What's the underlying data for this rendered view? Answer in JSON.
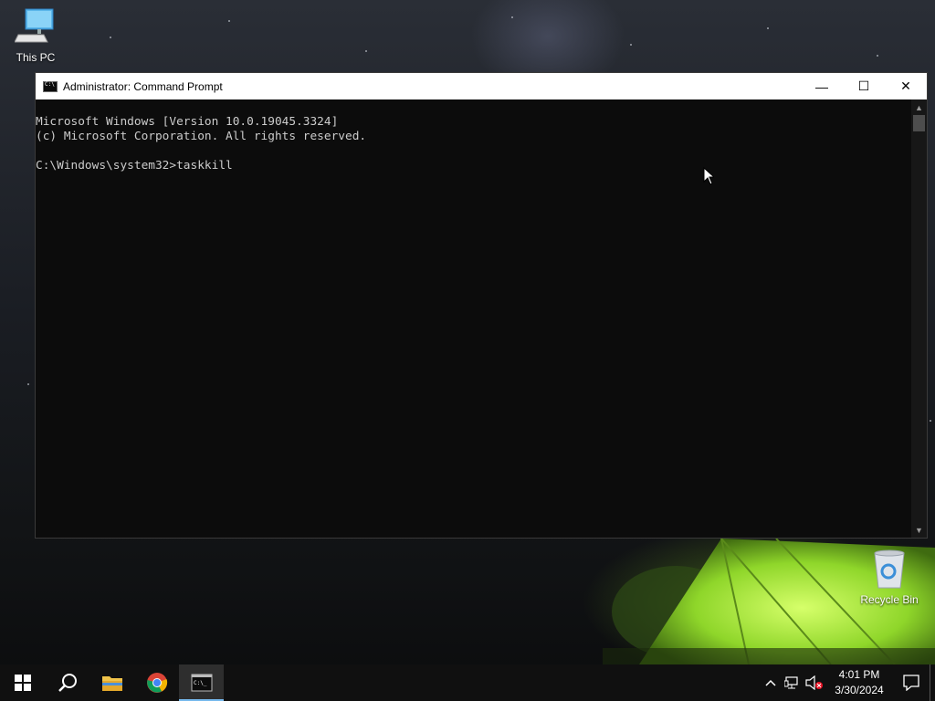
{
  "desktop": {
    "icons": [
      {
        "label": "This PC"
      },
      {
        "label": "Recycle Bin"
      }
    ]
  },
  "window": {
    "title": "Administrator: Command Prompt",
    "controls": {
      "minimize": "—",
      "maximize": "☐",
      "close": "✕"
    },
    "console_lines": [
      "Microsoft Windows [Version 10.0.19045.3324]",
      "(c) Microsoft Corporation. All rights reserved.",
      "",
      "C:\\Windows\\system32>taskkill"
    ]
  },
  "taskbar": {
    "pinned": [
      {
        "name": "start-button",
        "icon": "windows-logo"
      },
      {
        "name": "search-button",
        "icon": "search-icon"
      },
      {
        "name": "file-explorer-button",
        "icon": "folder-icon"
      },
      {
        "name": "chrome-button",
        "icon": "chrome-icon"
      },
      {
        "name": "command-prompt-button",
        "icon": "cmd-icon",
        "active": true
      }
    ],
    "clock": {
      "time": "4:01 PM",
      "date": "3/30/2024"
    }
  },
  "colors": {
    "console_bg": "#0c0c0c",
    "console_text": "#cccccc",
    "taskbar_bg": "#101010",
    "accent": "#76b9ed"
  }
}
